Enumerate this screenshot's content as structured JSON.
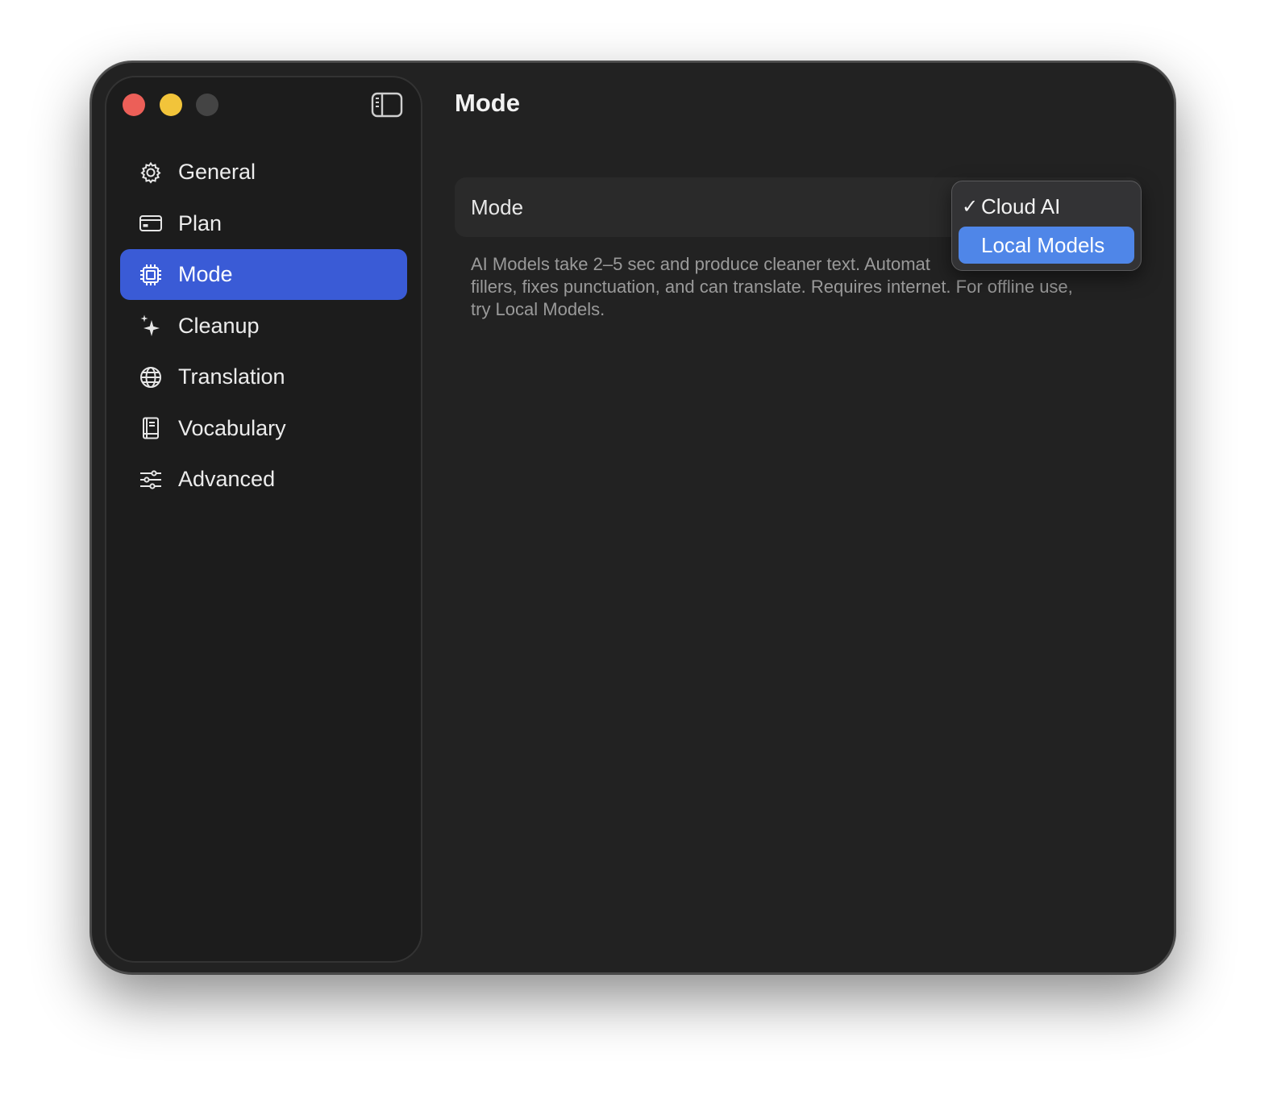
{
  "sidebar": {
    "items": [
      {
        "label": "General",
        "icon": "gear-icon"
      },
      {
        "label": "Plan",
        "icon": "credit-card-icon"
      },
      {
        "label": "Mode",
        "icon": "cpu-chip-icon",
        "active": true
      },
      {
        "label": "Cleanup",
        "icon": "sparkles-icon"
      },
      {
        "label": "Translation",
        "icon": "globe-icon"
      },
      {
        "label": "Vocabulary",
        "icon": "book-icon"
      },
      {
        "label": "Advanced",
        "icon": "sliders-icon"
      }
    ]
  },
  "main": {
    "title": "Mode",
    "mode_row": {
      "label": "Mode"
    },
    "description": "AI Models take 2–5 sec and produce cleaner text. Automat",
    "description_line2": "fillers, fixes punctuation, and can translate. Requires internet. For offline use,",
    "description_line3": "try Local Models."
  },
  "dropdown": {
    "options": [
      {
        "label": "Cloud AI",
        "selected": true,
        "check": "✓"
      },
      {
        "label": "Local Models",
        "highlighted": true,
        "check": ""
      }
    ]
  },
  "colors": {
    "accent": "#3a5bd6",
    "menu_highlight": "#4f86e8",
    "close": "#ec5f58",
    "minimize": "#f2c43a"
  }
}
